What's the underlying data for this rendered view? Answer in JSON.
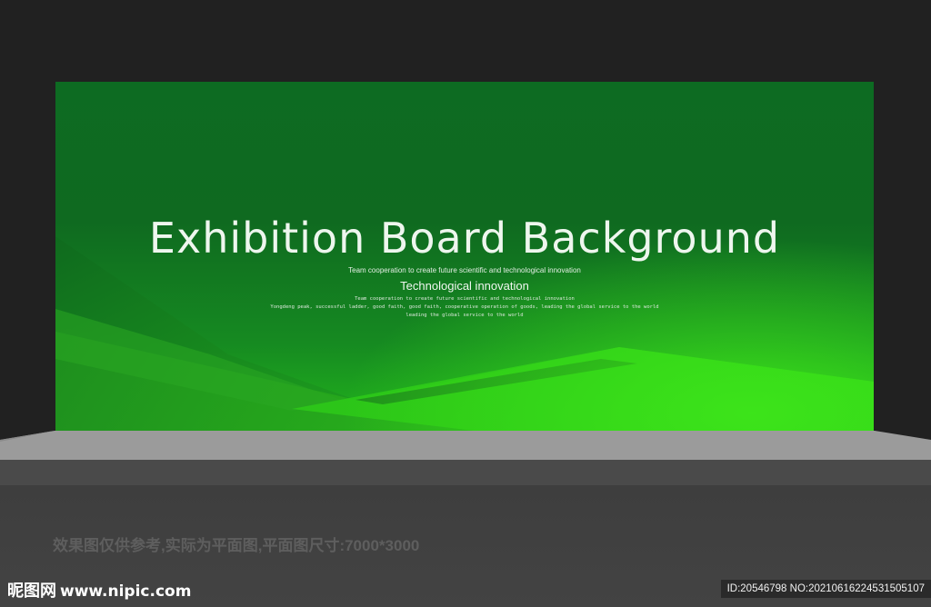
{
  "board": {
    "title": "Exhibition Board Background",
    "subtitle_small": "Team cooperation to create future scientific and technological innovation",
    "subtitle": "Technological innovation",
    "line1": "Team cooperation to create future scientific and technological innovation",
    "line2": "Yongdeng peak, successful ladder, good faith, good faith, cooperative operation of goods, leading the global service to the world",
    "line3": "leading the global service to the world"
  },
  "floor": {
    "note": "效果图仅供参考,实际为平面图,平面图尺寸:7000*3000"
  },
  "watermark": {
    "logo": "昵图网",
    "url": "www.nipic.com",
    "id_text": "ID:20546798 NO:20210616224531505107"
  },
  "colors": {
    "board_dark": "#0d6b22",
    "board_bright": "#2dd41a",
    "stage_top": "#9a9a9a",
    "background": "#212121"
  }
}
